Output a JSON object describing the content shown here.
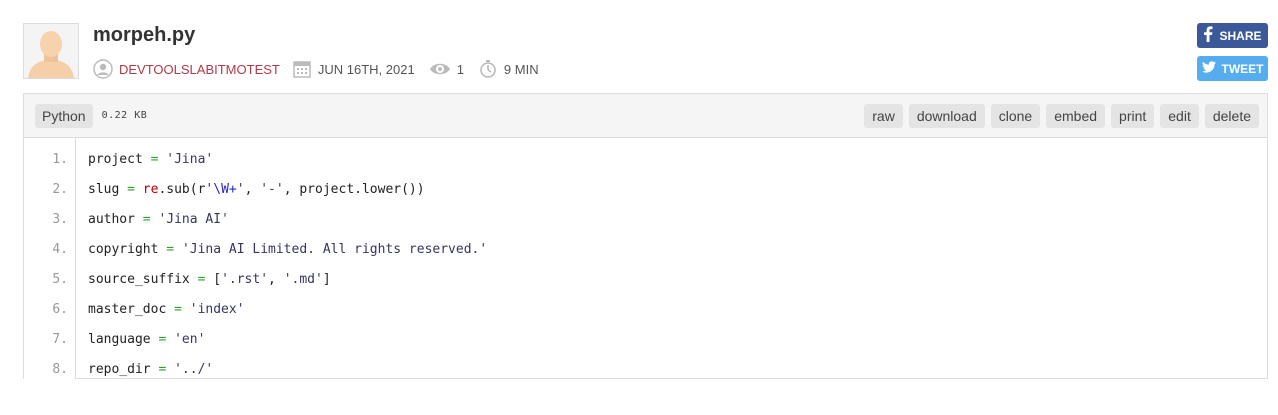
{
  "paste": {
    "title": "morpeh.py",
    "author": "DEVTOOLSLABITMOTEST",
    "date": "JUN 16TH, 2021",
    "views": "1",
    "expiry": "9 MIN"
  },
  "social": {
    "share_label": "SHARE",
    "tweet_label": "TWEET"
  },
  "code": {
    "language": "Python",
    "size": "0.22 KB",
    "actions": [
      "raw",
      "download",
      "clone",
      "embed",
      "print",
      "edit",
      "delete"
    ],
    "line_numbers": [
      "1.",
      "2.",
      "3.",
      "4.",
      "5.",
      "6.",
      "7.",
      "8."
    ],
    "lines": [
      [
        {
          "t": "project "
        },
        {
          "t": "=",
          "c": "op"
        },
        {
          "t": " "
        },
        {
          "t": "'Jina'",
          "c": "str"
        }
      ],
      [
        {
          "t": "slug "
        },
        {
          "t": "=",
          "c": "op"
        },
        {
          "t": " "
        },
        {
          "t": "re",
          "c": "fn"
        },
        {
          "t": ".sub(r"
        },
        {
          "t": "'",
          "c": "str"
        },
        {
          "t": "\\W+",
          "c": "esc"
        },
        {
          "t": "'",
          "c": "str"
        },
        {
          "t": ", "
        },
        {
          "t": "'-'",
          "c": "str"
        },
        {
          "t": ", project.lower())"
        }
      ],
      [
        {
          "t": "author "
        },
        {
          "t": "=",
          "c": "op"
        },
        {
          "t": " "
        },
        {
          "t": "'Jina AI'",
          "c": "str"
        }
      ],
      [
        {
          "t": "copyright "
        },
        {
          "t": "=",
          "c": "op"
        },
        {
          "t": " "
        },
        {
          "t": "'Jina AI Limited. All rights reserved.'",
          "c": "str"
        }
      ],
      [
        {
          "t": "source_suffix "
        },
        {
          "t": "=",
          "c": "op"
        },
        {
          "t": " ["
        },
        {
          "t": "'.rst'",
          "c": "str"
        },
        {
          "t": ", "
        },
        {
          "t": "'.md'",
          "c": "str"
        },
        {
          "t": "]"
        }
      ],
      [
        {
          "t": "master_doc "
        },
        {
          "t": "=",
          "c": "op"
        },
        {
          "t": " "
        },
        {
          "t": "'index'",
          "c": "str"
        }
      ],
      [
        {
          "t": "language "
        },
        {
          "t": "=",
          "c": "op"
        },
        {
          "t": " "
        },
        {
          "t": "'en'",
          "c": "str"
        }
      ],
      [
        {
          "t": "repo_dir "
        },
        {
          "t": "=",
          "c": "op"
        },
        {
          "t": " "
        },
        {
          "t": "'../'",
          "c": "str"
        }
      ]
    ]
  },
  "colors": {
    "author": "#b03a48",
    "share_bg": "#3b5998",
    "tweet_bg": "#55acee"
  },
  "icons": [
    "user-icon",
    "calendar-icon",
    "eye-icon",
    "stopwatch-icon",
    "facebook-icon",
    "twitter-icon"
  ]
}
